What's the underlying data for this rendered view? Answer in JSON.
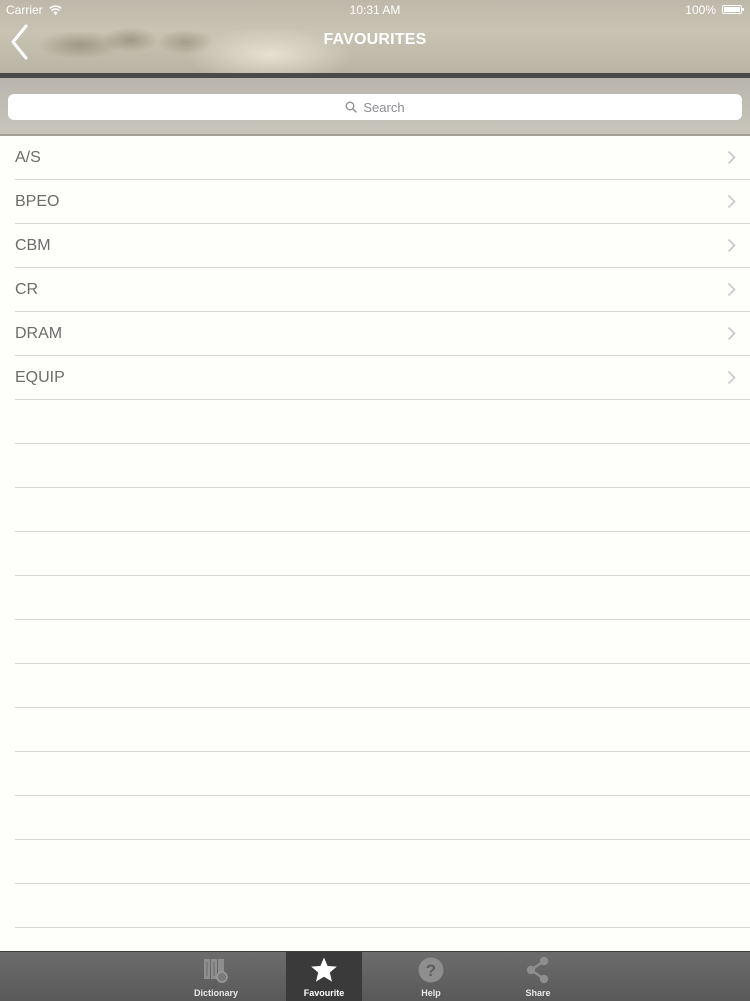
{
  "status_bar": {
    "carrier": "Carrier",
    "time": "10:31 AM",
    "battery": "100%"
  },
  "nav": {
    "title": "FAVOURITES",
    "back_icon": "chevron-left-icon"
  },
  "search": {
    "placeholder": "Search",
    "icon": "search-icon"
  },
  "list": {
    "items": [
      {
        "label": "A/S"
      },
      {
        "label": "BPEO"
      },
      {
        "label": "CBM"
      },
      {
        "label": "CR"
      },
      {
        "label": "DRAM"
      },
      {
        "label": "EQUIP"
      }
    ],
    "empty_rows": 12
  },
  "tab_bar": {
    "tabs": [
      {
        "label": "Dictionary",
        "icon": "dictionary-icon",
        "selected": false
      },
      {
        "label": "Favourite",
        "icon": "star-icon",
        "selected": true
      },
      {
        "label": "Help",
        "icon": "help-icon",
        "selected": false
      },
      {
        "label": "Share",
        "icon": "share-icon",
        "selected": false
      }
    ]
  },
  "colors": {
    "tab_bar": "#595959",
    "selected_tab": "#3a3a3a",
    "row_text": "#6c6c6c",
    "separator": "#d8d8d3"
  }
}
